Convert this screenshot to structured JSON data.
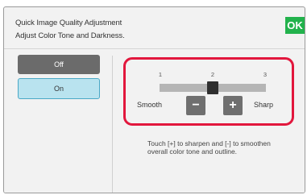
{
  "header": {
    "title": "Quick Image Quality Adjustment",
    "subtitle": "Adjust Color Tone and Darkness.",
    "ok_label": "OK"
  },
  "mode": {
    "off_label": "Off",
    "on_label": "On",
    "selected": "On"
  },
  "slider": {
    "ticks": [
      "1",
      "2",
      "3"
    ],
    "value": 2,
    "min_label": "Smooth",
    "max_label": "Sharp",
    "minus_label": "−",
    "plus_label": "+"
  },
  "hint": {
    "line1": "Touch [+] to sharpen and [-] to smoothen",
    "line2": "overall color tone and outline."
  },
  "colors": {
    "ok": "#22b24c",
    "highlight": "#e2173d",
    "selected_fill": "#b9e3ef",
    "selected_border": "#4aa8c6"
  }
}
